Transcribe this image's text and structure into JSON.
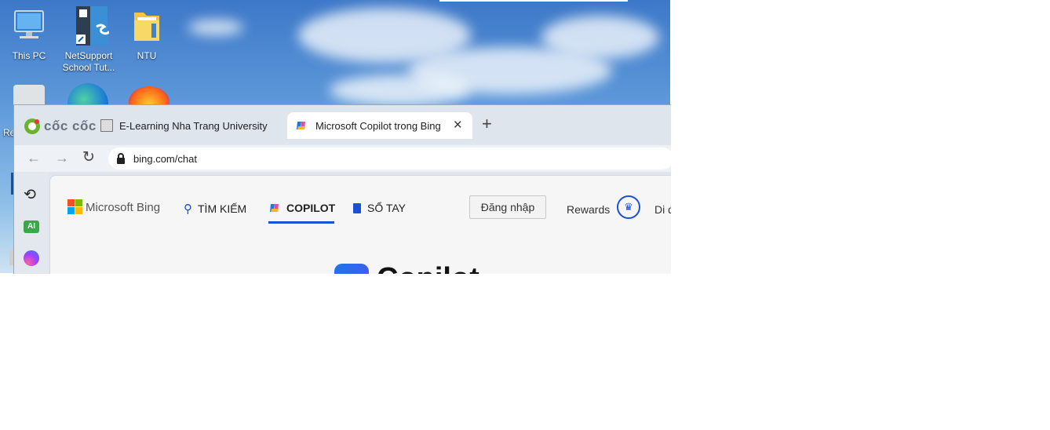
{
  "desktop": {
    "icons": [
      {
        "label": "This PC",
        "icon": "computer-icon"
      },
      {
        "label": "NetSupport\nSchool Tut...",
        "icon": "netsupport-icon"
      },
      {
        "label": "NTU",
        "icon": "folder-icon"
      },
      {
        "label": "Re",
        "icon": "recycle-bin-icon"
      }
    ]
  },
  "browser": {
    "brand": "cốc cốc",
    "tabs": [
      {
        "label": "E-Learning Nha Trang University",
        "icon": "moodle-icon"
      },
      {
        "label": "Microsoft Copilot trong Bing",
        "icon": "copilot-icon",
        "active": true
      }
    ],
    "new_tab_label": "+",
    "close_tab_label": "×",
    "url": "bing.com/chat"
  },
  "page": {
    "logo": "Microsoft Bing",
    "nav": [
      {
        "label": "TÌM KIẾM",
        "icon": "search-icon"
      },
      {
        "label": "COPILOT",
        "icon": "copilot-icon",
        "active": true
      },
      {
        "label": "SỔ TAY",
        "icon": "notebook-icon"
      }
    ],
    "login": "Đăng nhập",
    "rewards": "Rewards",
    "cut_text": "Di đ",
    "hero_title": "Copilot"
  },
  "colors": {
    "accent": "#1a4fd8",
    "copilot_underline": "#1a4fd8"
  }
}
